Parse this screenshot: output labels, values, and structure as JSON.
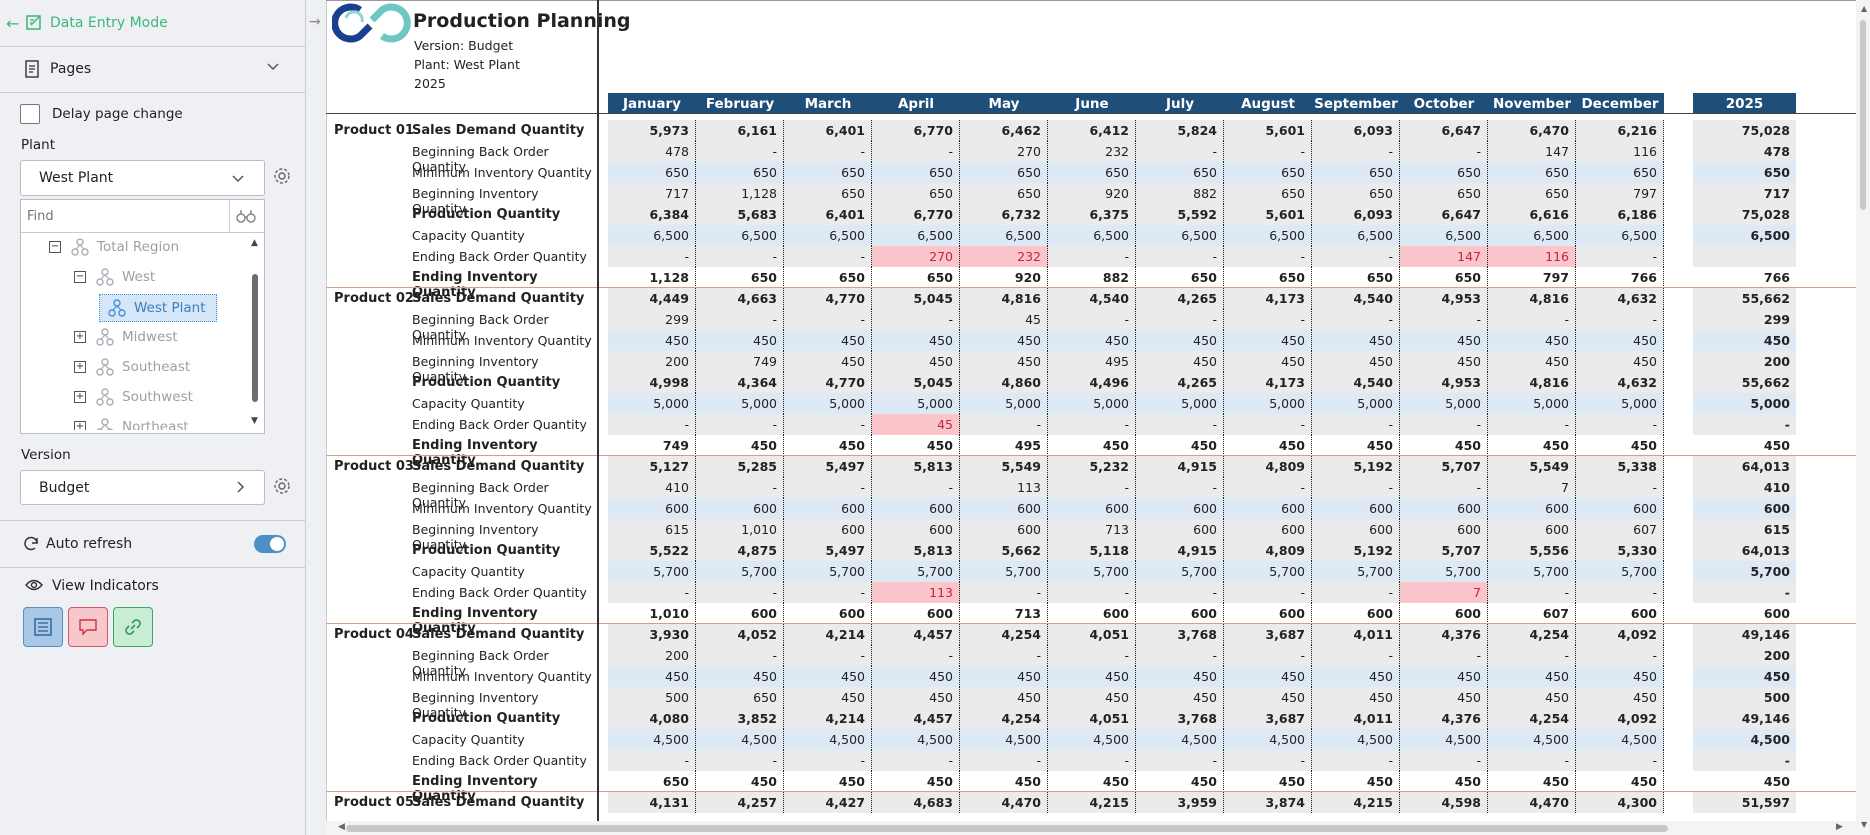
{
  "sidebar": {
    "mode_label": "Data Entry Mode",
    "pages_label": "Pages",
    "delay_label": "Delay page change",
    "plant_label": "Plant",
    "plant_value": "West Plant",
    "find_placeholder": "Find",
    "tree": [
      {
        "label": "Total Region",
        "expander": "−",
        "level": 0
      },
      {
        "label": "West",
        "expander": "−",
        "level": 1
      },
      {
        "label": "West Plant",
        "expander": "",
        "level": 2,
        "selected": true
      },
      {
        "label": "Midwest",
        "expander": "+",
        "level": 1
      },
      {
        "label": "Southeast",
        "expander": "+",
        "level": 1
      },
      {
        "label": "Southwest",
        "expander": "+",
        "level": 1
      },
      {
        "label": "Northeast",
        "expander": "+",
        "level": 1
      }
    ],
    "version_label": "Version",
    "version_value": "Budget",
    "auto_refresh_label": "Auto refresh",
    "auto_refresh_on": true,
    "view_indicators_label": "View Indicators",
    "indicator_icons": [
      "list-icon",
      "comment-icon",
      "link-icon"
    ]
  },
  "report": {
    "title": "Production Planning",
    "version_line": "Version: Budget",
    "plant_line": "Plant: West Plant",
    "year_line": "2025",
    "months": [
      "January",
      "February",
      "March",
      "April",
      "May",
      "June",
      "July",
      "August",
      "September",
      "October",
      "November",
      "December"
    ],
    "total_header": "2025",
    "products": [
      {
        "name": "Product 01",
        "rows": [
          {
            "label": "Sales Demand Quantity",
            "bold": true,
            "bg": "gray",
            "values": [
              "5,973",
              "6,161",
              "6,401",
              "6,770",
              "6,462",
              "6,412",
              "5,824",
              "5,601",
              "6,093",
              "6,647",
              "6,470",
              "6,216"
            ],
            "total": "75,028"
          },
          {
            "label": "Beginning Back Order Quantity",
            "bold": false,
            "bg": "gray",
            "values": [
              "478",
              "-",
              "-",
              "-",
              "270",
              "232",
              "-",
              "-",
              "-",
              "-",
              "147",
              "116"
            ],
            "total": "478"
          },
          {
            "label": "Minimum Inventory Quantity",
            "bold": false,
            "bg": "blue",
            "values": [
              "650",
              "650",
              "650",
              "650",
              "650",
              "650",
              "650",
              "650",
              "650",
              "650",
              "650",
              "650"
            ],
            "total": "650"
          },
          {
            "label": "Beginning Inventory Quantity",
            "bold": false,
            "bg": "gray",
            "values": [
              "717",
              "1,128",
              "650",
              "650",
              "650",
              "920",
              "882",
              "650",
              "650",
              "650",
              "650",
              "797"
            ],
            "total": "717"
          },
          {
            "label": "Production Quantity",
            "bold": true,
            "bg": "gray",
            "values": [
              "6,384",
              "5,683",
              "6,401",
              "6,770",
              "6,732",
              "6,375",
              "5,592",
              "5,601",
              "6,093",
              "6,647",
              "6,616",
              "6,186"
            ],
            "total": "75,028"
          },
          {
            "label": "Capacity Quantity",
            "bold": false,
            "bg": "blue",
            "values": [
              "6,500",
              "6,500",
              "6,500",
              "6,500",
              "6,500",
              "6,500",
              "6,500",
              "6,500",
              "6,500",
              "6,500",
              "6,500",
              "6,500"
            ],
            "total": "6,500"
          },
          {
            "label": "Ending Back Order Quantity",
            "bold": false,
            "bg": "gray",
            "values": [
              "-",
              "-",
              "-",
              "270",
              "232",
              "-",
              "-",
              "-",
              "-",
              "147",
              "116",
              "-"
            ],
            "total": "",
            "red": [
              3,
              4,
              9,
              10
            ]
          },
          {
            "label": "Ending Inventory Quantity",
            "bold": true,
            "bg": "white",
            "values": [
              "1,128",
              "650",
              "650",
              "650",
              "920",
              "882",
              "650",
              "650",
              "650",
              "650",
              "797",
              "766"
            ],
            "total": "766"
          }
        ]
      },
      {
        "name": "Product 02",
        "rows": [
          {
            "label": "Sales Demand Quantity",
            "bold": true,
            "bg": "gray",
            "values": [
              "4,449",
              "4,663",
              "4,770",
              "5,045",
              "4,816",
              "4,540",
              "4,265",
              "4,173",
              "4,540",
              "4,953",
              "4,816",
              "4,632"
            ],
            "total": "55,662"
          },
          {
            "label": "Beginning Back Order Quantity",
            "bold": false,
            "bg": "gray",
            "values": [
              "299",
              "-",
              "-",
              "-",
              "45",
              "-",
              "-",
              "-",
              "-",
              "-",
              "-",
              "-"
            ],
            "total": "299"
          },
          {
            "label": "Minimum Inventory Quantity",
            "bold": false,
            "bg": "blue",
            "values": [
              "450",
              "450",
              "450",
              "450",
              "450",
              "450",
              "450",
              "450",
              "450",
              "450",
              "450",
              "450"
            ],
            "total": "450"
          },
          {
            "label": "Beginning Inventory Quantity",
            "bold": false,
            "bg": "gray",
            "values": [
              "200",
              "749",
              "450",
              "450",
              "450",
              "495",
              "450",
              "450",
              "450",
              "450",
              "450",
              "450"
            ],
            "total": "200"
          },
          {
            "label": "Production Quantity",
            "bold": true,
            "bg": "gray",
            "values": [
              "4,998",
              "4,364",
              "4,770",
              "5,045",
              "4,860",
              "4,496",
              "4,265",
              "4,173",
              "4,540",
              "4,953",
              "4,816",
              "4,632"
            ],
            "total": "55,662"
          },
          {
            "label": "Capacity Quantity",
            "bold": false,
            "bg": "blue",
            "values": [
              "5,000",
              "5,000",
              "5,000",
              "5,000",
              "5,000",
              "5,000",
              "5,000",
              "5,000",
              "5,000",
              "5,000",
              "5,000",
              "5,000"
            ],
            "total": "5,000"
          },
          {
            "label": "Ending Back Order Quantity",
            "bold": false,
            "bg": "gray",
            "values": [
              "-",
              "-",
              "-",
              "45",
              "-",
              "-",
              "-",
              "-",
              "-",
              "-",
              "-",
              "-"
            ],
            "total": "-",
            "red": [
              3
            ]
          },
          {
            "label": "Ending Inventory Quantity",
            "bold": true,
            "bg": "white",
            "values": [
              "749",
              "450",
              "450",
              "450",
              "495",
              "450",
              "450",
              "450",
              "450",
              "450",
              "450",
              "450"
            ],
            "total": "450"
          }
        ]
      },
      {
        "name": "Product 03",
        "rows": [
          {
            "label": "Sales Demand Quantity",
            "bold": true,
            "bg": "gray",
            "values": [
              "5,127",
              "5,285",
              "5,497",
              "5,813",
              "5,549",
              "5,232",
              "4,915",
              "4,809",
              "5,192",
              "5,707",
              "5,549",
              "5,338"
            ],
            "total": "64,013"
          },
          {
            "label": "Beginning Back Order Quantity",
            "bold": false,
            "bg": "gray",
            "values": [
              "410",
              "-",
              "-",
              "-",
              "113",
              "-",
              "-",
              "-",
              "-",
              "-",
              "7",
              "-"
            ],
            "total": "410"
          },
          {
            "label": "Minimum Inventory Quantity",
            "bold": false,
            "bg": "blue",
            "values": [
              "600",
              "600",
              "600",
              "600",
              "600",
              "600",
              "600",
              "600",
              "600",
              "600",
              "600",
              "600"
            ],
            "total": "600"
          },
          {
            "label": "Beginning Inventory Quantity",
            "bold": false,
            "bg": "gray",
            "values": [
              "615",
              "1,010",
              "600",
              "600",
              "600",
              "713",
              "600",
              "600",
              "600",
              "600",
              "600",
              "607"
            ],
            "total": "615"
          },
          {
            "label": "Production Quantity",
            "bold": true,
            "bg": "gray",
            "values": [
              "5,522",
              "4,875",
              "5,497",
              "5,813",
              "5,662",
              "5,118",
              "4,915",
              "4,809",
              "5,192",
              "5,707",
              "5,556",
              "5,330"
            ],
            "total": "64,013"
          },
          {
            "label": "Capacity Quantity",
            "bold": false,
            "bg": "blue",
            "values": [
              "5,700",
              "5,700",
              "5,700",
              "5,700",
              "5,700",
              "5,700",
              "5,700",
              "5,700",
              "5,700",
              "5,700",
              "5,700",
              "5,700"
            ],
            "total": "5,700"
          },
          {
            "label": "Ending Back Order Quantity",
            "bold": false,
            "bg": "gray",
            "values": [
              "-",
              "-",
              "-",
              "113",
              "-",
              "-",
              "-",
              "-",
              "-",
              "7",
              "-",
              "-"
            ],
            "total": "-",
            "red": [
              3,
              9
            ]
          },
          {
            "label": "Ending Inventory Quantity",
            "bold": true,
            "bg": "white",
            "values": [
              "1,010",
              "600",
              "600",
              "600",
              "713",
              "600",
              "600",
              "600",
              "600",
              "600",
              "607",
              "600"
            ],
            "total": "600"
          }
        ]
      },
      {
        "name": "Product 04",
        "rows": [
          {
            "label": "Sales Demand Quantity",
            "bold": true,
            "bg": "gray",
            "values": [
              "3,930",
              "4,052",
              "4,214",
              "4,457",
              "4,254",
              "4,051",
              "3,768",
              "3,687",
              "4,011",
              "4,376",
              "4,254",
              "4,092"
            ],
            "total": "49,146"
          },
          {
            "label": "Beginning Back Order Quantity",
            "bold": false,
            "bg": "gray",
            "values": [
              "200",
              "-",
              "-",
              "-",
              "-",
              "-",
              "-",
              "-",
              "-",
              "-",
              "-",
              "-"
            ],
            "total": "200"
          },
          {
            "label": "Minimum Inventory Quantity",
            "bold": false,
            "bg": "blue",
            "values": [
              "450",
              "450",
              "450",
              "450",
              "450",
              "450",
              "450",
              "450",
              "450",
              "450",
              "450",
              "450"
            ],
            "total": "450"
          },
          {
            "label": "Beginning Inventory Quantity",
            "bold": false,
            "bg": "gray",
            "values": [
              "500",
              "650",
              "450",
              "450",
              "450",
              "450",
              "450",
              "450",
              "450",
              "450",
              "450",
              "450"
            ],
            "total": "500"
          },
          {
            "label": "Production Quantity",
            "bold": true,
            "bg": "gray",
            "values": [
              "4,080",
              "3,852",
              "4,214",
              "4,457",
              "4,254",
              "4,051",
              "3,768",
              "3,687",
              "4,011",
              "4,376",
              "4,254",
              "4,092"
            ],
            "total": "49,146"
          },
          {
            "label": "Capacity Quantity",
            "bold": false,
            "bg": "blue",
            "values": [
              "4,500",
              "4,500",
              "4,500",
              "4,500",
              "4,500",
              "4,500",
              "4,500",
              "4,500",
              "4,500",
              "4,500",
              "4,500",
              "4,500"
            ],
            "total": "4,500"
          },
          {
            "label": "Ending Back Order Quantity",
            "bold": false,
            "bg": "gray",
            "values": [
              "-",
              "-",
              "-",
              "-",
              "-",
              "-",
              "-",
              "-",
              "-",
              "-",
              "-",
              "-"
            ],
            "total": "-"
          },
          {
            "label": "Ending Inventory Quantity",
            "bold": true,
            "bg": "white",
            "values": [
              "650",
              "450",
              "450",
              "450",
              "450",
              "450",
              "450",
              "450",
              "450",
              "450",
              "450",
              "450"
            ],
            "total": "450"
          }
        ]
      },
      {
        "name": "Product 05",
        "rows": [
          {
            "label": "Sales Demand Quantity",
            "bold": true,
            "bg": "gray",
            "values": [
              "4,131",
              "4,257",
              "4,427",
              "4,683",
              "4,470",
              "4,215",
              "3,959",
              "3,874",
              "4,215",
              "4,598",
              "4,470",
              "4,300"
            ],
            "total": "51,597"
          }
        ]
      }
    ]
  },
  "colors": {
    "header_bg": "#1f4e79",
    "accent_green": "#3cb878",
    "input_blue": "#ddeaf6",
    "calc_gray": "#ebebeb",
    "alert_red_bg": "#fbc5cc",
    "alert_red_text": "#c0283e"
  }
}
